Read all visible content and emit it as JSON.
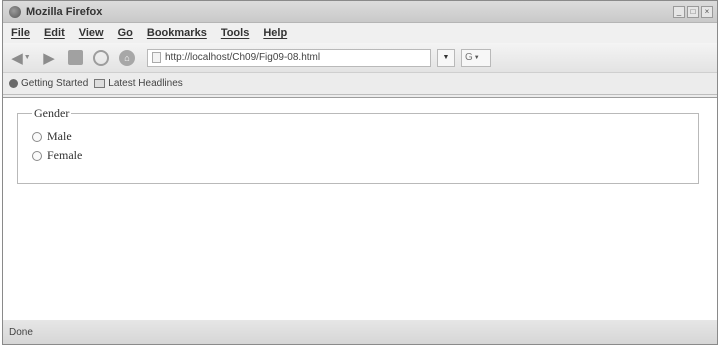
{
  "window": {
    "title": "Mozilla Firefox",
    "controls": [
      "_",
      "□",
      "×"
    ]
  },
  "menu": [
    "File",
    "Edit",
    "View",
    "Go",
    "Bookmarks",
    "Tools",
    "Help"
  ],
  "navigation": {
    "url": "http://localhost/Ch09/Fig09-08.html"
  },
  "bookmarks": {
    "items": [
      "Getting Started",
      "Latest Headlines"
    ]
  },
  "form": {
    "legend": "Gender",
    "options": [
      "Male",
      "Female"
    ]
  },
  "status": {
    "text": "Done"
  },
  "colors": {
    "chrome_background": "#ececec",
    "content_background": "#ffffff"
  }
}
